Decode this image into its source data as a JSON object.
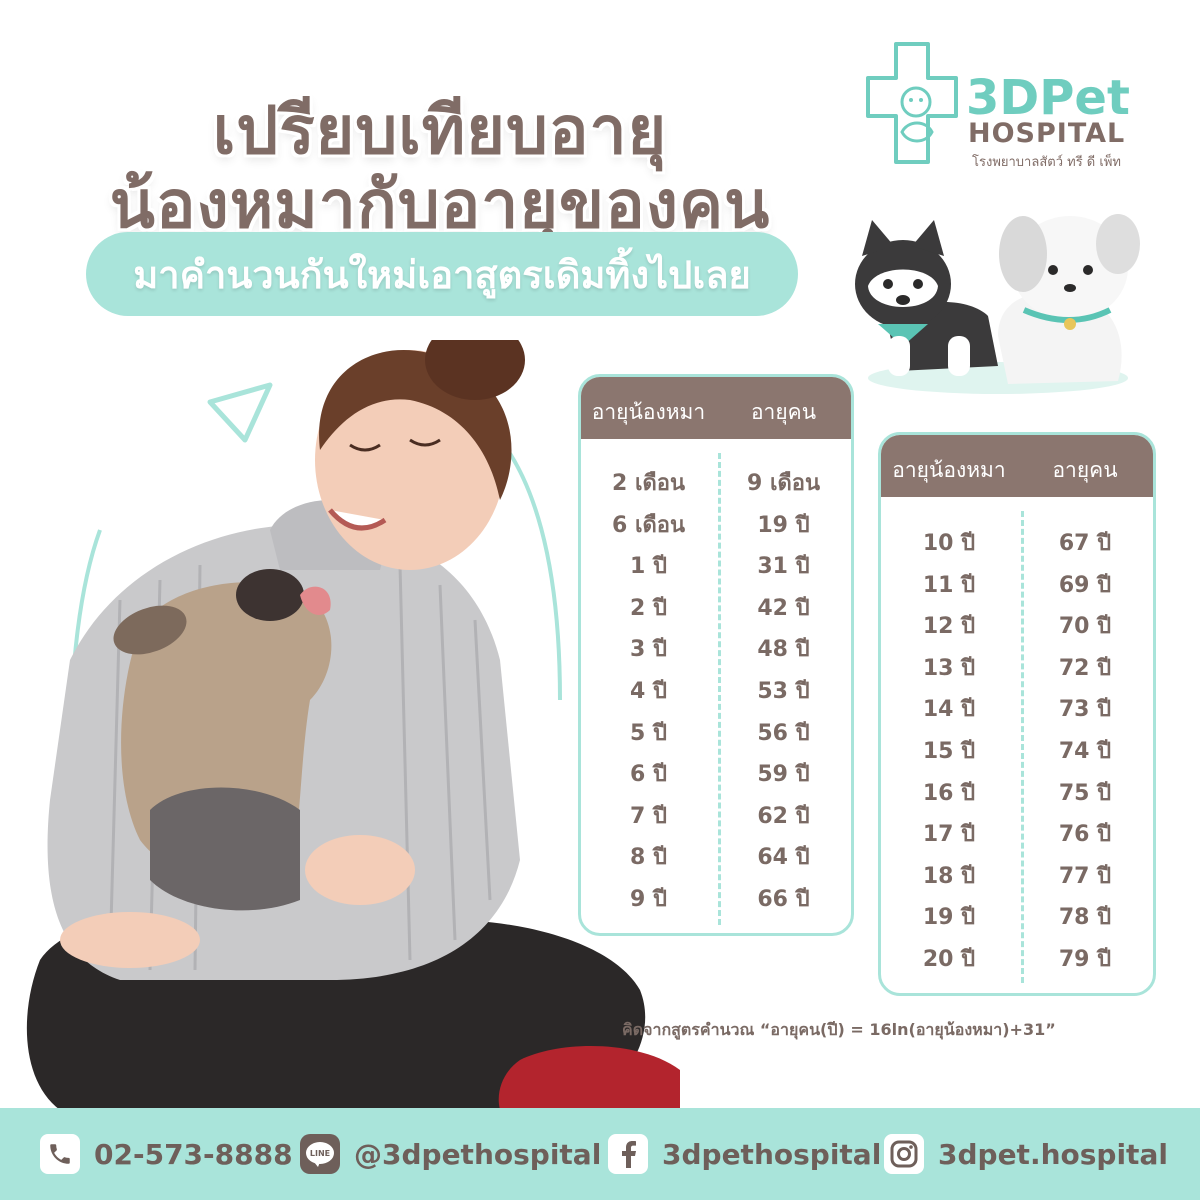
{
  "title": {
    "line1": "เปรียบเทียบอายุ",
    "line2": "น้องหมากับอายุของคน",
    "subtitle": "มาคำนวนกันใหม่เอาสูตรเดิมทิ้งไปเลย"
  },
  "logo": {
    "brand": "3DPet",
    "name": "HOSPITAL",
    "thai": "โรงพยาบาลสัตว์ ทรี ดี เพ็ท",
    "icon": "cross-with-pets-logo-icon"
  },
  "colors": {
    "mint": "#a9e4da",
    "brown": "#8b766f",
    "text": "#7a6a64"
  },
  "table1": {
    "headers": [
      "อายุน้องหมา",
      "อายุคน"
    ],
    "rows": [
      [
        "2 เดือน",
        "9 เดือน"
      ],
      [
        "6 เดือน",
        "19 ปี"
      ],
      [
        "1 ปี",
        "31 ปี"
      ],
      [
        "2 ปี",
        "42 ปี"
      ],
      [
        "3 ปี",
        "48 ปี"
      ],
      [
        "4 ปี",
        "53 ปี"
      ],
      [
        "5 ปี",
        "56 ปี"
      ],
      [
        "6 ปี",
        "59 ปี"
      ],
      [
        "7 ปี",
        "62 ปี"
      ],
      [
        "8 ปี",
        "64 ปี"
      ],
      [
        "9 ปี",
        "66 ปี"
      ]
    ]
  },
  "table2": {
    "headers": [
      "อายุน้องหมา",
      "อายุคน"
    ],
    "rows": [
      [
        "10 ปี",
        "67 ปี"
      ],
      [
        "11 ปี",
        "69 ปี"
      ],
      [
        "12 ปี",
        "70 ปี"
      ],
      [
        "13 ปี",
        "72 ปี"
      ],
      [
        "14 ปี",
        "73 ปี"
      ],
      [
        "15 ปี",
        "74 ปี"
      ],
      [
        "16 ปี",
        "75 ปี"
      ],
      [
        "17 ปี",
        "76 ปี"
      ],
      [
        "18 ปี",
        "77 ปี"
      ],
      [
        "19 ปี",
        "78 ปี"
      ],
      [
        "20 ปี",
        "79 ปี"
      ]
    ]
  },
  "formula": "คิดจากสูตรคำนวณ  “อายุคน(ปี) = 16ln(อายุน้องหมา)+31”",
  "footer": {
    "phone": "02-573-8888",
    "line": "@3dpethospital",
    "facebook": "3dpethospital",
    "instagram": "3dpet.hospital"
  },
  "illustrations": {
    "cartoon_dogs": "husky-and-white-puppy-cartoon",
    "photo": "woman-hugging-french-bulldog-photo"
  }
}
